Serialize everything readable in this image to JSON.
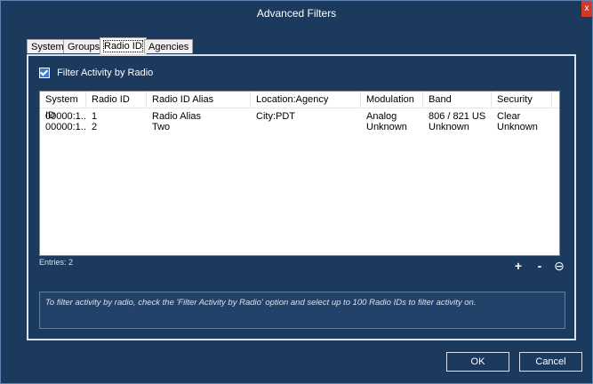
{
  "window": {
    "title": "Advanced Filters",
    "close_glyph": "x"
  },
  "tabs": [
    {
      "label": "System"
    },
    {
      "label": "Groups"
    },
    {
      "label": "Radio ID",
      "active": true
    },
    {
      "label": "Agencies"
    }
  ],
  "filter": {
    "checkbox_label": "Filter Activity by Radio",
    "checked": true
  },
  "table": {
    "columns": [
      "System ID",
      "Radio ID",
      "Radio ID Alias",
      "Location:Agency",
      "Modulation",
      "Band",
      "Security"
    ],
    "rows": [
      [
        "00000:1...",
        "1",
        "Radio Alias",
        "City:PDT",
        "Analog",
        "806 / 821 US",
        "Clear"
      ],
      [
        "00000:1...",
        "2",
        "Two",
        "",
        "Unknown",
        "Unknown",
        "Unknown"
      ]
    ]
  },
  "entries_label": "Entries: 2",
  "controls": {
    "add": "+",
    "remove": "-",
    "clear": "⊖"
  },
  "hint_text": "To filter activity by radio, check the 'Filter Activity by Radio' option and select up to 100 Radio IDs to filter activity on.",
  "buttons": {
    "ok": "OK",
    "cancel": "Cancel"
  },
  "colors": {
    "background": "#1c3a5e",
    "accent": "#3a7bd5",
    "close": "#d0392b"
  }
}
